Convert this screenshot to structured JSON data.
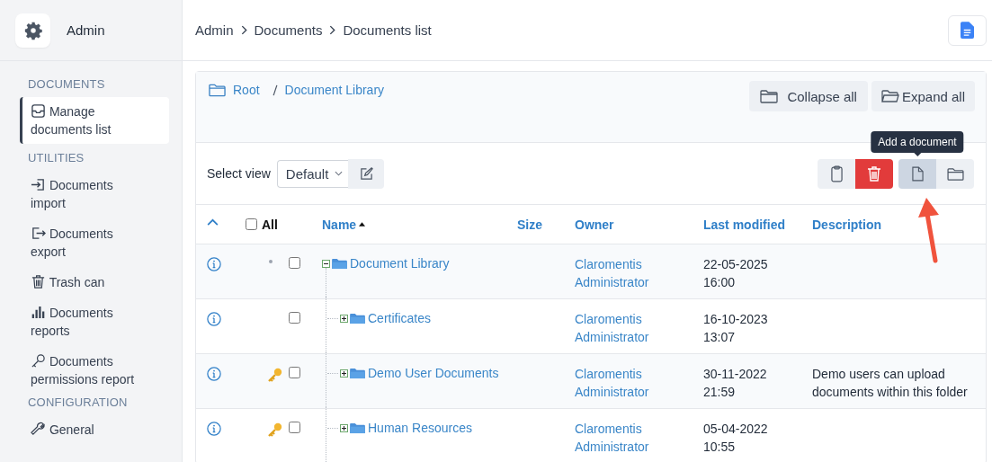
{
  "sidebar": {
    "app_label": "Admin",
    "sections": [
      {
        "title": "DOCUMENTS",
        "items": [
          {
            "label": "Manage documents list",
            "selected": true
          }
        ]
      },
      {
        "title": "UTILITIES",
        "items": [
          {
            "label": "Documents import",
            "selected": false
          },
          {
            "label": "Documents export",
            "selected": false
          },
          {
            "label": "Trash can",
            "selected": false
          },
          {
            "label": "Documents reports",
            "selected": false
          },
          {
            "label": "Documents permissions report",
            "selected": false
          }
        ]
      },
      {
        "title": "CONFIGURATION",
        "items": [
          {
            "label": "General",
            "selected": false
          }
        ]
      }
    ]
  },
  "breadcrumbs": [
    "Admin",
    "Documents",
    "Documents list"
  ],
  "folder_path": [
    "Root",
    "Document Library"
  ],
  "tree_buttons": [
    "Collapse all",
    "Expand all"
  ],
  "view": {
    "label": "Select view",
    "value": "Default"
  },
  "actions": [
    {
      "hovered": false
    },
    {
      "hovered": false
    },
    {
      "hovered": true,
      "tooltip": "Add a document"
    },
    {
      "hovered": false
    }
  ],
  "table": {
    "select_all": {
      "label": "All",
      "checked": false
    },
    "columns": [
      {
        "label": "Name",
        "sorted": true
      },
      {
        "label": "Size",
        "sorted": false
      },
      {
        "label": "Owner",
        "sorted": false
      },
      {
        "label": "Last modified",
        "sorted": false
      },
      {
        "label": "Description",
        "sorted": false
      }
    ],
    "rows": [
      {
        "name": "Document Library",
        "key": false,
        "checked": false,
        "expanded": true,
        "owner": "Claromentis Administrator",
        "modified": "22-05-2025 16:00",
        "children": [
          {
            "name": "Certificates",
            "key": false,
            "checked": false,
            "expanded": false,
            "owner": "Claromentis Administrator",
            "modified": "16-10-2023 13:07"
          },
          {
            "name": "Demo User Documents",
            "key": true,
            "checked": false,
            "expanded": false,
            "owner": "Claromentis Administrator",
            "modified": "30-11-2022 21:59",
            "description": "Demo users can upload documents within this folder"
          },
          {
            "name": "Human Resources",
            "key": true,
            "checked": false,
            "expanded": false,
            "owner": "Claromentis Administrator",
            "modified": "05-04-2022 10:55"
          }
        ]
      }
    ]
  }
}
